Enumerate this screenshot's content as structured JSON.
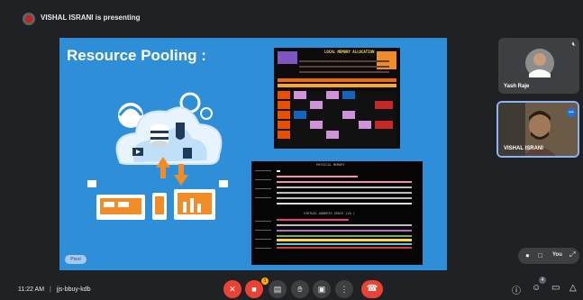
{
  "presenter": {
    "banner": "VISHAL ISRANI is presenting"
  },
  "slide": {
    "title": "Resource Pooling :",
    "prezi_badge": "Prezi",
    "screenshot_top_title": "LOCAL MEMORY ALLOCATION",
    "screenshot_bottom_title_1": "PHYSICAL MEMORY",
    "screenshot_bottom_title_2": "VIRTUAL ADDRESS SPACE (VA )"
  },
  "participants": [
    {
      "name": "Yash Raje",
      "muted": true
    },
    {
      "name": "VISHAL ISRANI",
      "speaking": true
    }
  ],
  "self_view": {
    "label": "You"
  },
  "meeting": {
    "time": "11:22 AM",
    "separator": "|",
    "code": "jjs-bbuy-kdb",
    "raise_hand_count": "1",
    "people_count": "4"
  },
  "colors": {
    "background": "#202124",
    "slide_blue": "#2e8fd8",
    "control_red": "#ea4335",
    "control_gray": "#3c4043",
    "accent_blue": "#1a73e8"
  },
  "icons": {
    "mic": "mic-off-icon",
    "camera": "camera-off-icon",
    "captions": "captions-icon",
    "hand": "raise-hand-icon",
    "present": "present-icon",
    "more": "more-vert-icon",
    "hangup": "call-end-icon",
    "info": "info-icon",
    "people": "people-icon",
    "chat": "chat-icon",
    "activities": "activities-icon"
  }
}
